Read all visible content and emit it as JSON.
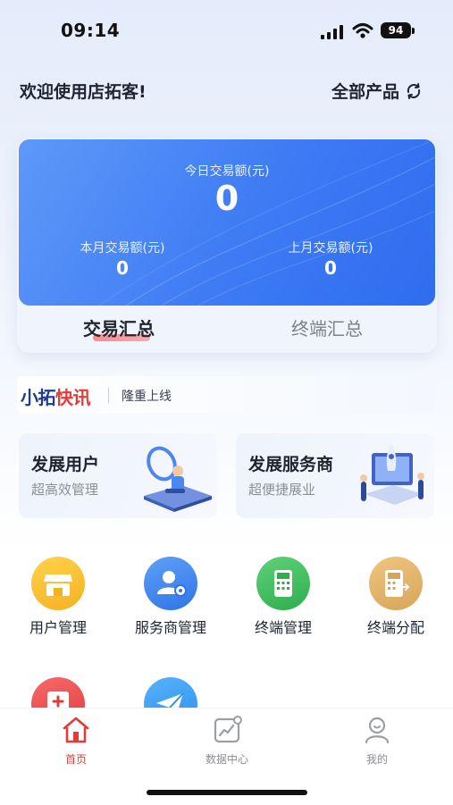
{
  "status_bar": {
    "time": "09:14",
    "battery": "94"
  },
  "header": {
    "welcome": "欢迎使用店拓客!",
    "product_switch": "全部产品"
  },
  "summary": {
    "today_label": "今日交易额(元)",
    "today_value": "0",
    "month_label": "本月交易额(元)",
    "month_value": "0",
    "last_month_label": "上月交易额(元)",
    "last_month_value": "0",
    "tabs": [
      {
        "label": "交易汇总",
        "active": true
      },
      {
        "label": "终端汇总",
        "active": false
      }
    ]
  },
  "news": {
    "logo_part1": "小拓",
    "logo_part2": "快讯",
    "text": "隆重上线"
  },
  "promos": [
    {
      "title": "发展用户",
      "subtitle": "超高效管理"
    },
    {
      "title": "发展服务商",
      "subtitle": "超便捷展业"
    }
  ],
  "functions": [
    {
      "label": "用户管理",
      "icon": "store-icon",
      "color": "#f4b223"
    },
    {
      "label": "服务商管理",
      "icon": "users-icon",
      "color": "#2f74e8"
    },
    {
      "label": "终端管理",
      "icon": "pos-terminal-icon",
      "color": "#2eae4e"
    },
    {
      "label": "终端分配",
      "icon": "terminal-assign-icon",
      "color": "#d7a55a"
    },
    {
      "label": "",
      "icon": "medical-cross-icon",
      "color": "#e23b3b"
    },
    {
      "label": "",
      "icon": "paper-plane-icon",
      "color": "#2d8ef0"
    }
  ],
  "bottom_nav": [
    {
      "label": "首页",
      "icon": "home-icon",
      "active": true
    },
    {
      "label": "数据中心",
      "icon": "chart-icon",
      "active": false
    },
    {
      "label": "我的",
      "icon": "profile-icon",
      "active": false
    }
  ],
  "colors": {
    "accent": "#e23b3b",
    "card_blue": "#3e7bf4"
  }
}
